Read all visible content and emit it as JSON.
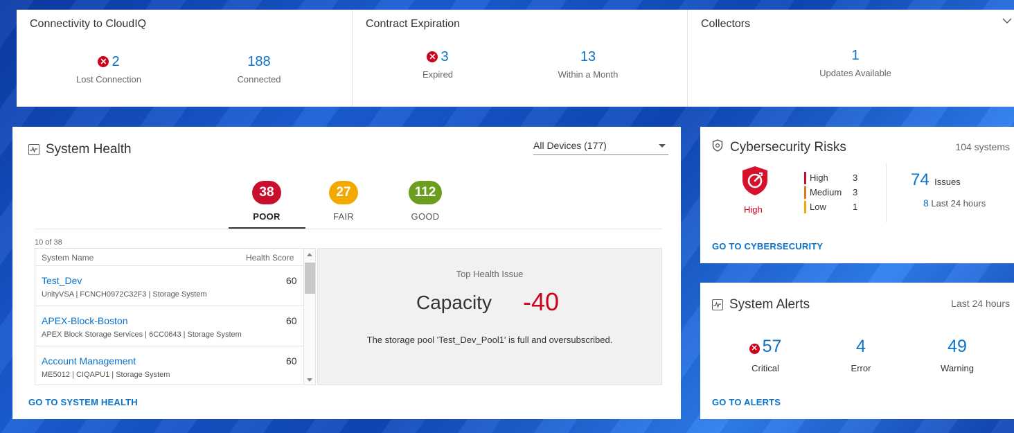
{
  "connectivity": {
    "title": "Connectivity to CloudIQ",
    "lost_value": "2",
    "lost_label": "Lost Connection",
    "connected_value": "188",
    "connected_label": "Connected"
  },
  "contract": {
    "title": "Contract Expiration",
    "expired_value": "3",
    "expired_label": "Expired",
    "month_value": "13",
    "month_label": "Within a Month"
  },
  "collectors": {
    "title": "Collectors",
    "updates_value": "1",
    "updates_label": "Updates Available"
  },
  "health": {
    "title": "System Health",
    "device_filter": "All Devices (177)",
    "tabs": [
      {
        "count": "38",
        "label": "POOR",
        "color": "#c8102e"
      },
      {
        "count": "27",
        "label": "FAIR",
        "color": "#f2a900"
      },
      {
        "count": "112",
        "label": "GOOD",
        "color": "#6b9e1f"
      }
    ],
    "count_text": "10 of 38",
    "columns": {
      "name": "System Name",
      "score": "Health Score"
    },
    "rows": [
      {
        "name": "Test_Dev",
        "sub": "UnityVSA | FCNCH0972C32F3 | Storage System",
        "score": "60"
      },
      {
        "name": "APEX-Block-Boston",
        "sub": "APEX Block Storage Services | 6CC0643 | Storage System",
        "score": "60"
      },
      {
        "name": "Account Management",
        "sub": "ME5012 | CIQAPU1 | Storage System",
        "score": "60"
      }
    ],
    "issue": {
      "title": "Top Health Issue",
      "category": "Capacity",
      "impact": "-40",
      "description": "The storage pool 'Test_Dev_Pool1' is full and oversubscribed."
    },
    "link": "GO TO SYSTEM HEALTH"
  },
  "cyber": {
    "title": "Cybersecurity Risks",
    "systems": "104 systems",
    "risk_level": "High",
    "levels": [
      {
        "label": "High",
        "value": "3",
        "color": "#c8102e"
      },
      {
        "label": "Medium",
        "value": "3",
        "color": "#e07a10"
      },
      {
        "label": "Low",
        "value": "1",
        "color": "#f2a900"
      }
    ],
    "issues_value": "74",
    "issues_label": "Issues",
    "last_value": "8",
    "last_label": "Last 24 hours",
    "link": "GO TO CYBERSECURITY"
  },
  "alerts": {
    "title": "System Alerts",
    "period": "Last 24 hours",
    "critical_value": "57",
    "critical_label": "Critical",
    "error_value": "4",
    "error_label": "Error",
    "warning_value": "49",
    "warning_label": "Warning",
    "link": "GO TO ALERTS"
  },
  "icons": {
    "error": "x-circle-icon",
    "pulse": "pulse-icon",
    "shield": "shield-icon",
    "chevron": "chevron-down-icon"
  }
}
